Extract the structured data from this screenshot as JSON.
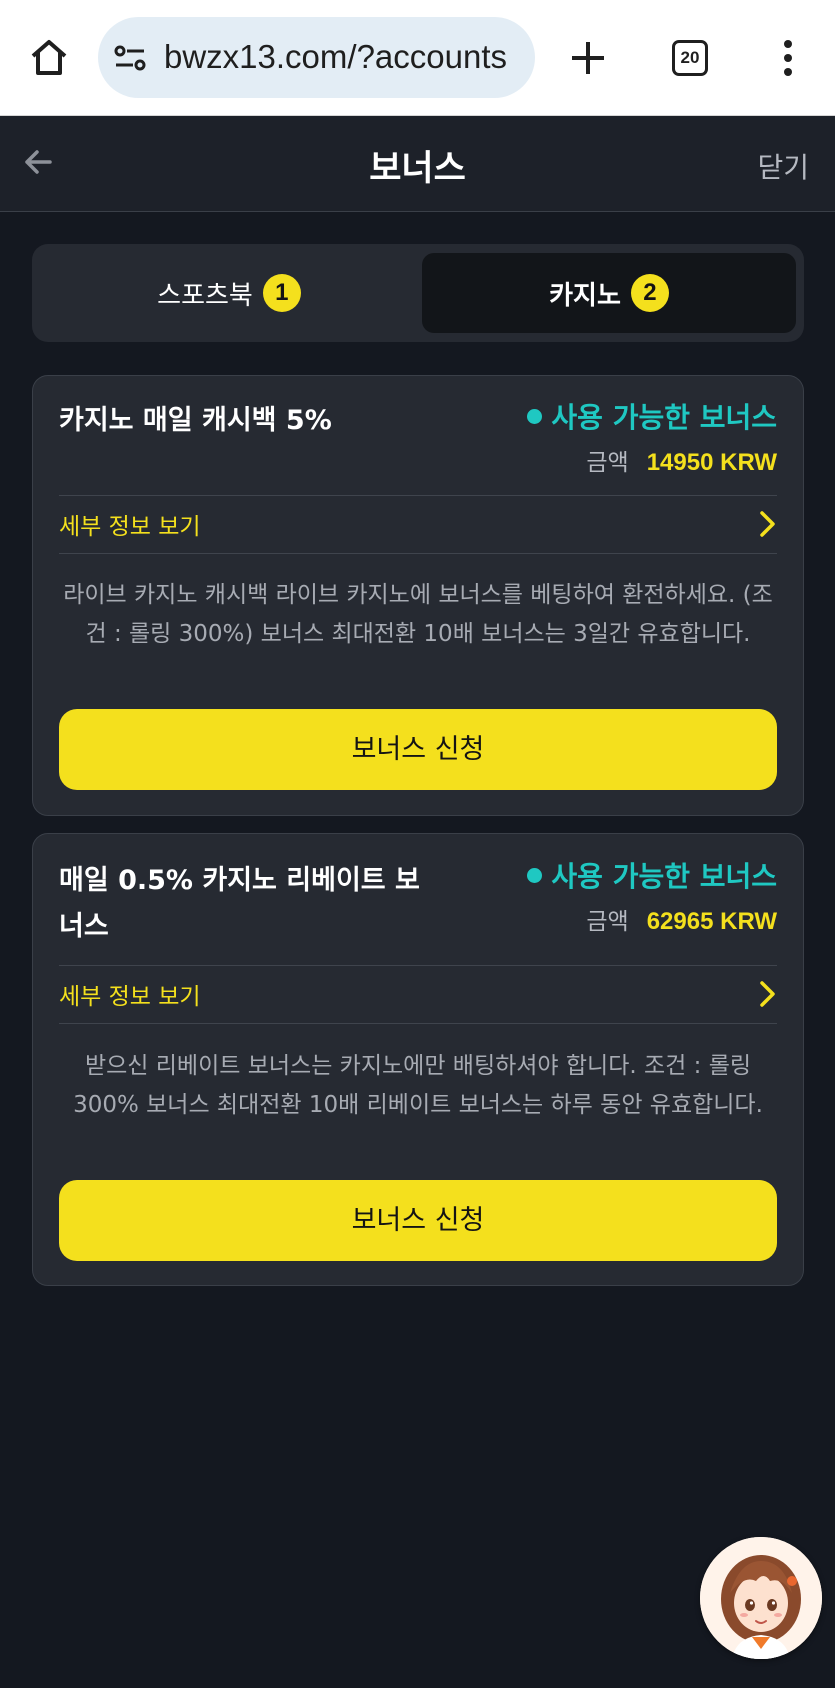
{
  "browser": {
    "url": "bwzx13.com/?accounts",
    "tab_count": "20"
  },
  "header": {
    "title": "보너스",
    "close_label": "닫기"
  },
  "tabs": [
    {
      "label": "스포츠북",
      "badge": "1",
      "active": false
    },
    {
      "label": "카지노",
      "badge": "2",
      "active": true
    }
  ],
  "cards": [
    {
      "title": "카지노 매일 캐시백 5%",
      "status": "사용 가능한 보너스",
      "amount_label": "금액",
      "amount_value": "14950 KRW",
      "details_label": "세부 정보 보기",
      "description": "라이브 카지노 캐시백 라이브 카지노에 보너스를 베팅하여 환전하세요. (조건 : 롤링 300%) 보너스 최대전환 10배 보너스는 3일간 유효합니다.",
      "button_label": "보너스 신청"
    },
    {
      "title": "매일 0.5% 카지노 리베이트 보너스",
      "status": "사용 가능한 보너스",
      "amount_label": "금액",
      "amount_value": "62965 KRW",
      "details_label": "세부 정보 보기",
      "description": "받으신 리베이트 보너스는 카지노에만 배팅하셔야 합니다. 조건 : 롤링 300% 보너스 최대전환 10배 리베이트 보너스는 하루 동안 유효합니다.",
      "button_label": "보너스 신청"
    }
  ],
  "colors": {
    "accent_yellow": "#f4e01d",
    "status_teal": "#1fc8c2",
    "background": "#141820",
    "card": "#262a32"
  },
  "icons": [
    "home-icon",
    "site-settings-icon",
    "plus-icon",
    "tabs-icon",
    "more-vert-icon",
    "back-arrow-icon",
    "chevron-right-icon",
    "support-avatar"
  ]
}
